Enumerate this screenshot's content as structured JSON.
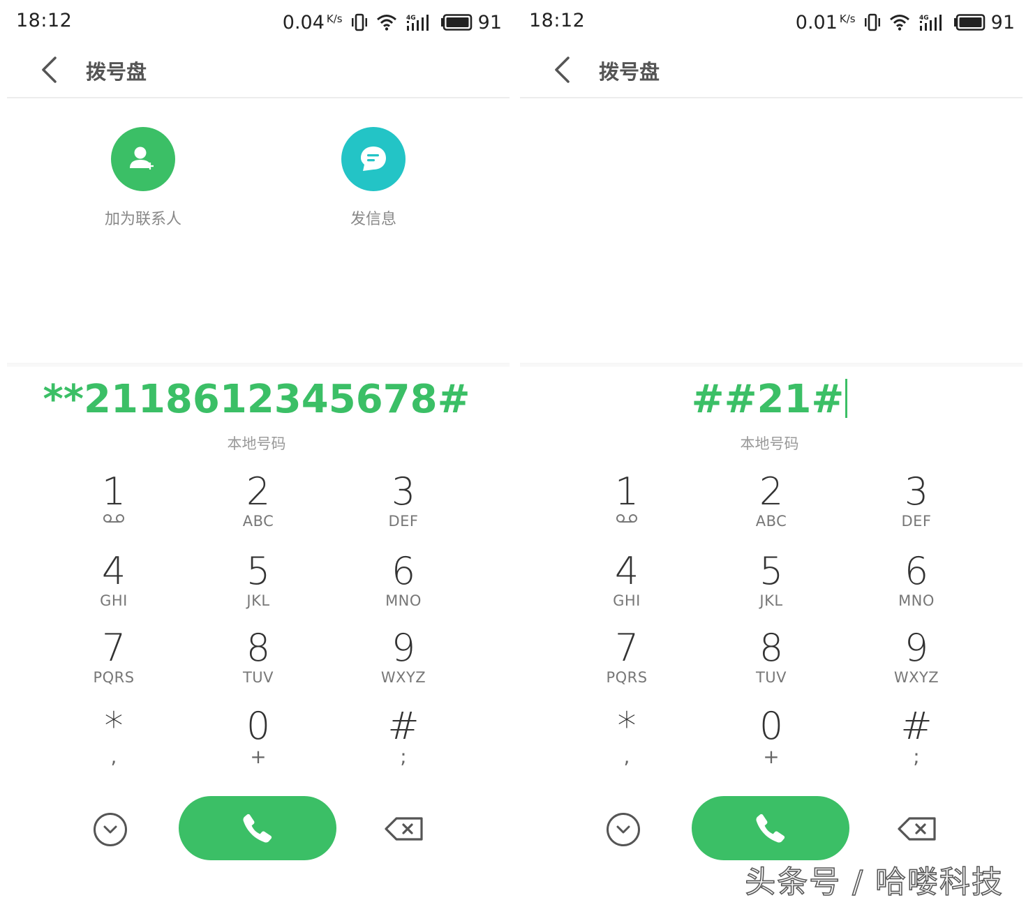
{
  "screens": [
    {
      "status": {
        "time": "18:12",
        "speed": "0.04",
        "speed_unit": "K/s",
        "battery": "91"
      },
      "header": {
        "title": "拨号盘"
      },
      "actions": [
        {
          "label": "加为联系人",
          "icon": "add-contact-icon",
          "color": "#3bbf66"
        },
        {
          "label": "发信息",
          "icon": "message-icon",
          "color": "#23c4c6"
        }
      ],
      "dialed": "**2118612345678#",
      "location": "本地号码"
    },
    {
      "status": {
        "time": "18:12",
        "speed": "0.01",
        "speed_unit": "K/s",
        "battery": "91"
      },
      "header": {
        "title": "拨号盘"
      },
      "actions": [],
      "dialed": "##21#",
      "location": "本地号码"
    }
  ],
  "keypad": [
    {
      "digit": "1",
      "letters": "",
      "icon": "voicemail-icon"
    },
    {
      "digit": "2",
      "letters": "ABC"
    },
    {
      "digit": "3",
      "letters": "DEF"
    },
    {
      "digit": "4",
      "letters": "GHI"
    },
    {
      "digit": "5",
      "letters": "JKL"
    },
    {
      "digit": "6",
      "letters": "MNO"
    },
    {
      "digit": "7",
      "letters": "PQRS"
    },
    {
      "digit": "8",
      "letters": "TUV"
    },
    {
      "digit": "9",
      "letters": "WXYZ"
    },
    {
      "digit": "*",
      "letters": ","
    },
    {
      "digit": "0",
      "letters": "+"
    },
    {
      "digit": "#",
      "letters": ";"
    }
  ],
  "accent_color": "#3bbf66",
  "watermark": "头条号 / 哈喽科技"
}
